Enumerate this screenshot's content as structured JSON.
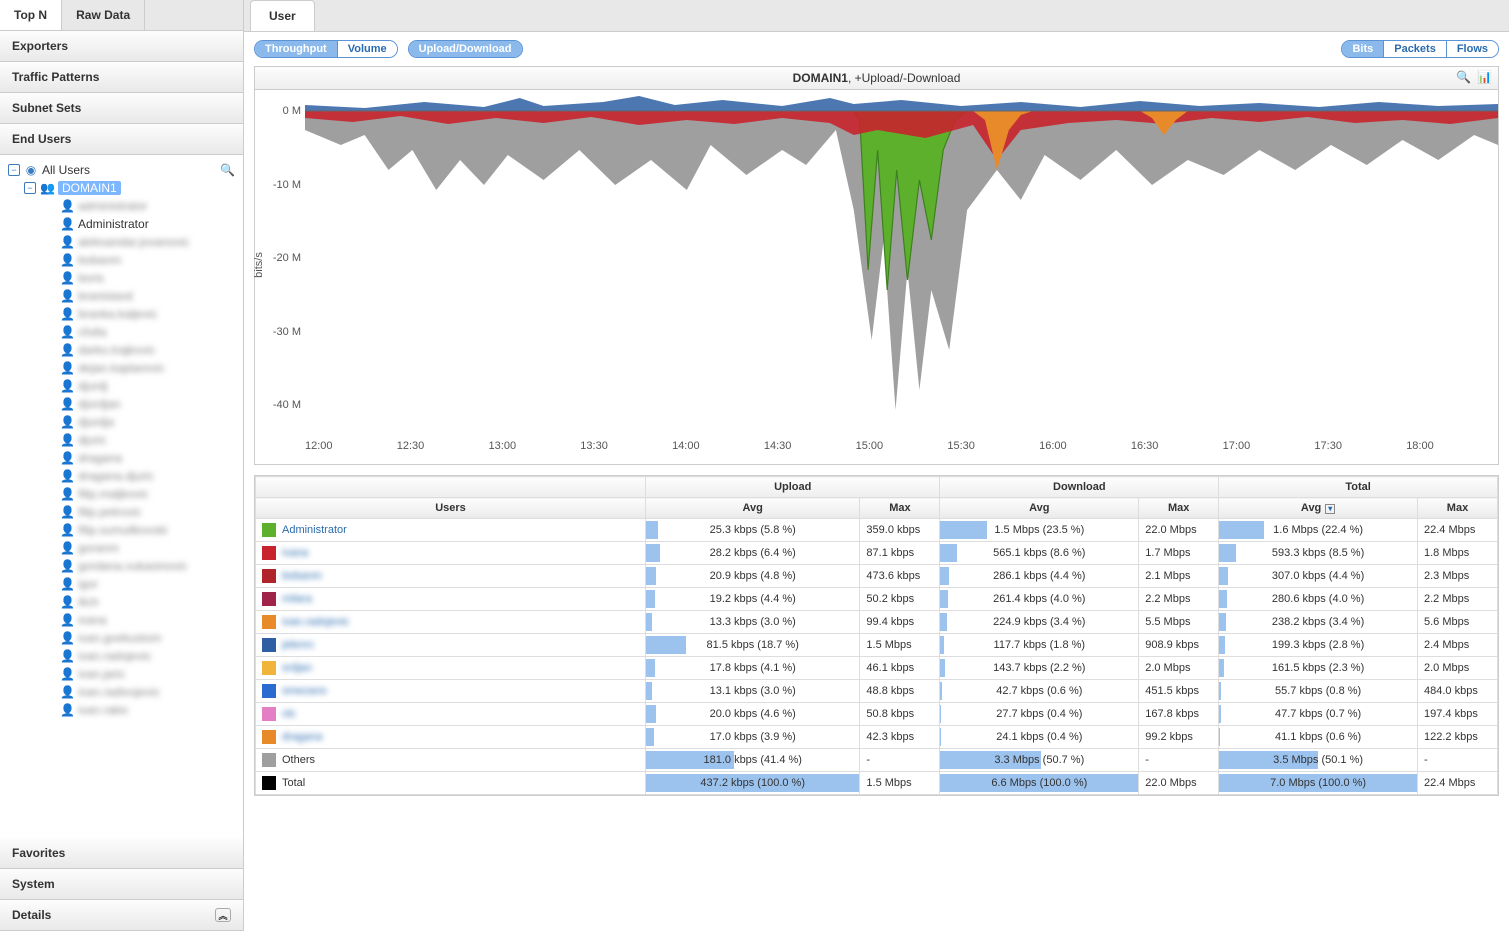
{
  "sidebar": {
    "tabs": [
      "Top N",
      "Raw Data"
    ],
    "active_tab": 0,
    "sections": [
      "Exporters",
      "Traffic Patterns",
      "Subnet Sets",
      "End Users"
    ],
    "active_section": 3,
    "tree": {
      "root": "All Users",
      "domain": "DOMAIN1",
      "users": [
        {
          "name": "administrator",
          "blurred": true
        },
        {
          "name": "Administrator",
          "blurred": false
        },
        {
          "name": "aleksandar.jovanovic",
          "blurred": true
        },
        {
          "name": "bobanm",
          "blurred": true
        },
        {
          "name": "boris",
          "blurred": true
        },
        {
          "name": "branislavd",
          "blurred": true
        },
        {
          "name": "branka.kaljevic",
          "blurred": true
        },
        {
          "name": "cfulta",
          "blurred": true
        },
        {
          "name": "darko.trajkovic",
          "blurred": true
        },
        {
          "name": "dejan.kaplarevic",
          "blurred": true
        },
        {
          "name": "djurdj",
          "blurred": true
        },
        {
          "name": "djordjan",
          "blurred": true
        },
        {
          "name": "djurdja",
          "blurred": true
        },
        {
          "name": "djuric",
          "blurred": true
        },
        {
          "name": "dragana",
          "blurred": true
        },
        {
          "name": "dragana.djuric",
          "blurred": true
        },
        {
          "name": "filip.maljkovic",
          "blurred": true
        },
        {
          "name": "filip.petrovic",
          "blurred": true
        },
        {
          "name": "filip.sumulikovski",
          "blurred": true
        },
        {
          "name": "goranm",
          "blurred": true
        },
        {
          "name": "gordana.vukasinovic",
          "blurred": true
        },
        {
          "name": "igor",
          "blurred": true
        },
        {
          "name": "ilich",
          "blurred": true
        },
        {
          "name": "ivana",
          "blurred": true
        },
        {
          "name": "ivan.gvekustom",
          "blurred": true
        },
        {
          "name": "ivan.radojevic",
          "blurred": true
        },
        {
          "name": "ivan.jaric",
          "blurred": true
        },
        {
          "name": "ivan.radivojevic",
          "blurred": true
        },
        {
          "name": "ivan.rakic",
          "blurred": true
        }
      ]
    },
    "bottom": [
      "Favorites",
      "System",
      "Details"
    ]
  },
  "main_tab": "User",
  "toolbar": {
    "metric_group": [
      "Throughput",
      "Volume"
    ],
    "metric_active": 0,
    "direction_group": [
      "Upload/Download"
    ],
    "direction_active": 0,
    "unit_group": [
      "Bits",
      "Packets",
      "Flows"
    ],
    "unit_active": 0
  },
  "chart_title": {
    "domain": "DOMAIN1",
    "suffix": ", +Upload/-Download"
  },
  "chart_data": {
    "type": "area",
    "ylabel": "bits/s",
    "y_ticks": [
      "0 M",
      "-10 M",
      "-20 M",
      "-30 M",
      "-40 M"
    ],
    "ylim": [
      -45,
      3
    ],
    "x_ticks": [
      "12:00",
      "12:30",
      "13:00",
      "13:30",
      "14:00",
      "14:30",
      "15:00",
      "15:30",
      "16:00",
      "16:30",
      "17:00",
      "17:30",
      "18:00"
    ],
    "series_colors": {
      "Administrator": "#5cb02c",
      "ivana": "#c8232c",
      "bobanm": "#b0242b",
      "milara": "#a0234a",
      "ivan.radojevic": "#e88a2a",
      "jelenrc": "#2e5fa3",
      "srdjan": "#f0b43a",
      "smezano": "#2a6bd0",
      "nlc": "#e47fc5",
      "dragana": "#e88a2a",
      "Others": "#9f9f9f",
      "Total": "#000000"
    }
  },
  "table": {
    "group_headers": [
      "",
      "Upload",
      "Download",
      "Total"
    ],
    "columns": [
      "Users",
      "Avg",
      "Max",
      "Avg",
      "Max",
      "Avg",
      "Max"
    ],
    "sort_col": 5,
    "rows": [
      {
        "color": "#5cb02c",
        "name": "Administrator",
        "blurred": false,
        "up_avg": "25.3 kbps (5.8 %)",
        "up_avg_pct": 5.8,
        "up_max": "359.0 kbps",
        "dn_avg": "1.5 Mbps (23.5 %)",
        "dn_avg_pct": 23.5,
        "dn_max": "22.0 Mbps",
        "tot_avg": "1.6 Mbps (22.4 %)",
        "tot_avg_pct": 22.4,
        "tot_max": "22.4 Mbps"
      },
      {
        "color": "#c8232c",
        "name": "ivana",
        "blurred": true,
        "up_avg": "28.2 kbps (6.4 %)",
        "up_avg_pct": 6.4,
        "up_max": "87.1 kbps",
        "dn_avg": "565.1 kbps (8.6 %)",
        "dn_avg_pct": 8.6,
        "dn_max": "1.7 Mbps",
        "tot_avg": "593.3 kbps (8.5 %)",
        "tot_avg_pct": 8.5,
        "tot_max": "1.8 Mbps"
      },
      {
        "color": "#b0242b",
        "name": "bobanm",
        "blurred": true,
        "up_avg": "20.9 kbps (4.8 %)",
        "up_avg_pct": 4.8,
        "up_max": "473.6 kbps",
        "dn_avg": "286.1 kbps (4.4 %)",
        "dn_avg_pct": 4.4,
        "dn_max": "2.1 Mbps",
        "tot_avg": "307.0 kbps (4.4 %)",
        "tot_avg_pct": 4.4,
        "tot_max": "2.3 Mbps"
      },
      {
        "color": "#a0234a",
        "name": "milara",
        "blurred": true,
        "up_avg": "19.2 kbps (4.4 %)",
        "up_avg_pct": 4.4,
        "up_max": "50.2 kbps",
        "dn_avg": "261.4 kbps (4.0 %)",
        "dn_avg_pct": 4.0,
        "dn_max": "2.2 Mbps",
        "tot_avg": "280.6 kbps (4.0 %)",
        "tot_avg_pct": 4.0,
        "tot_max": "2.2 Mbps"
      },
      {
        "color": "#e88a2a",
        "name": "ivan.radojevic",
        "blurred": true,
        "up_avg": "13.3 kbps (3.0 %)",
        "up_avg_pct": 3.0,
        "up_max": "99.4 kbps",
        "dn_avg": "224.9 kbps (3.4 %)",
        "dn_avg_pct": 3.4,
        "dn_max": "5.5 Mbps",
        "tot_avg": "238.2 kbps (3.4 %)",
        "tot_avg_pct": 3.4,
        "tot_max": "5.6 Mbps"
      },
      {
        "color": "#2e5fa3",
        "name": "jelenrc",
        "blurred": true,
        "up_avg": "81.5 kbps (18.7 %)",
        "up_avg_pct": 18.7,
        "up_max": "1.5 Mbps",
        "dn_avg": "117.7 kbps (1.8 %)",
        "dn_avg_pct": 1.8,
        "dn_max": "908.9 kbps",
        "tot_avg": "199.3 kbps (2.8 %)",
        "tot_avg_pct": 2.8,
        "tot_max": "2.4 Mbps"
      },
      {
        "color": "#f0b43a",
        "name": "srdjan",
        "blurred": true,
        "up_avg": "17.8 kbps (4.1 %)",
        "up_avg_pct": 4.1,
        "up_max": "46.1 kbps",
        "dn_avg": "143.7 kbps (2.2 %)",
        "dn_avg_pct": 2.2,
        "dn_max": "2.0 Mbps",
        "tot_avg": "161.5 kbps (2.3 %)",
        "tot_avg_pct": 2.3,
        "tot_max": "2.0 Mbps"
      },
      {
        "color": "#2a6bd0",
        "name": "smezano",
        "blurred": true,
        "up_avg": "13.1 kbps (3.0 %)",
        "up_avg_pct": 3.0,
        "up_max": "48.8 kbps",
        "dn_avg": "42.7 kbps (0.6 %)",
        "dn_avg_pct": 0.6,
        "dn_max": "451.5 kbps",
        "tot_avg": "55.7 kbps (0.8 %)",
        "tot_avg_pct": 0.8,
        "tot_max": "484.0 kbps"
      },
      {
        "color": "#e47fc5",
        "name": "nlc",
        "blurred": true,
        "up_avg": "20.0 kbps (4.6 %)",
        "up_avg_pct": 4.6,
        "up_max": "50.8 kbps",
        "dn_avg": "27.7 kbps (0.4 %)",
        "dn_avg_pct": 0.4,
        "dn_max": "167.8 kbps",
        "tot_avg": "47.7 kbps (0.7 %)",
        "tot_avg_pct": 0.7,
        "tot_max": "197.4 kbps"
      },
      {
        "color": "#e88a2a",
        "name": "dragana",
        "blurred": true,
        "up_avg": "17.0 kbps (3.9 %)",
        "up_avg_pct": 3.9,
        "up_max": "42.3 kbps",
        "dn_avg": "24.1 kbps (0.4 %)",
        "dn_avg_pct": 0.4,
        "dn_max": "99.2 kbps",
        "tot_avg": "41.1 kbps (0.6 %)",
        "tot_avg_pct": 0.6,
        "tot_max": "122.2 kbps"
      },
      {
        "color": "#9f9f9f",
        "name": "Others",
        "blurred": false,
        "up_avg": "181.0 kbps (41.4 %)",
        "up_avg_pct": 41.4,
        "up_max": "-",
        "dn_avg": "3.3 Mbps (50.7 %)",
        "dn_avg_pct": 50.7,
        "dn_max": "-",
        "tot_avg": "3.5 Mbps (50.1 %)",
        "tot_avg_pct": 50.1,
        "tot_max": "-"
      },
      {
        "color": "#000000",
        "name": "Total",
        "blurred": false,
        "up_avg": "437.2 kbps (100.0 %)",
        "up_avg_pct": 100.0,
        "up_max": "1.5 Mbps",
        "dn_avg": "6.6 Mbps (100.0 %)",
        "dn_avg_pct": 100.0,
        "dn_max": "22.0 Mbps",
        "tot_avg": "7.0 Mbps (100.0 %)",
        "tot_avg_pct": 100.0,
        "tot_max": "22.4 Mbps"
      }
    ]
  }
}
